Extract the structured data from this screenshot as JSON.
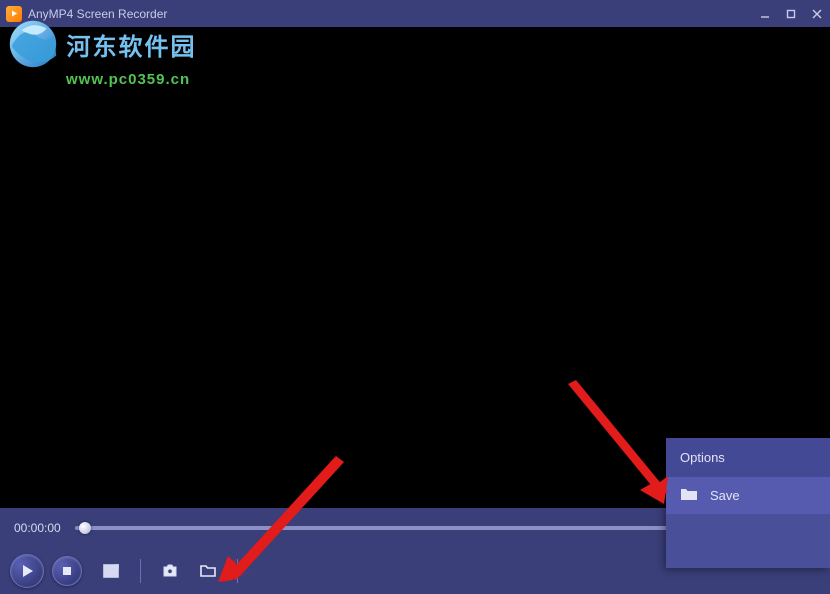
{
  "app": {
    "title": "AnyMP4 Screen Recorder"
  },
  "watermark": {
    "cn_text": "河东软件园",
    "url_text": "www.pc0359.cn"
  },
  "playback": {
    "time": "00:00:00",
    "progress_pct": 0
  },
  "controls": {
    "play_icon": "play-icon",
    "stop_icon": "stop-icon",
    "gif_icon": "aspect-icon",
    "snapshot_icon": "camera-icon",
    "open_folder_icon": "folder-icon"
  },
  "window_buttons": {
    "minimize": "minimize-icon",
    "maximize": "maximize-icon",
    "close": "close-icon"
  },
  "options": {
    "header": "Options",
    "items": [
      {
        "icon": "folder-icon",
        "label": "Save"
      }
    ]
  }
}
